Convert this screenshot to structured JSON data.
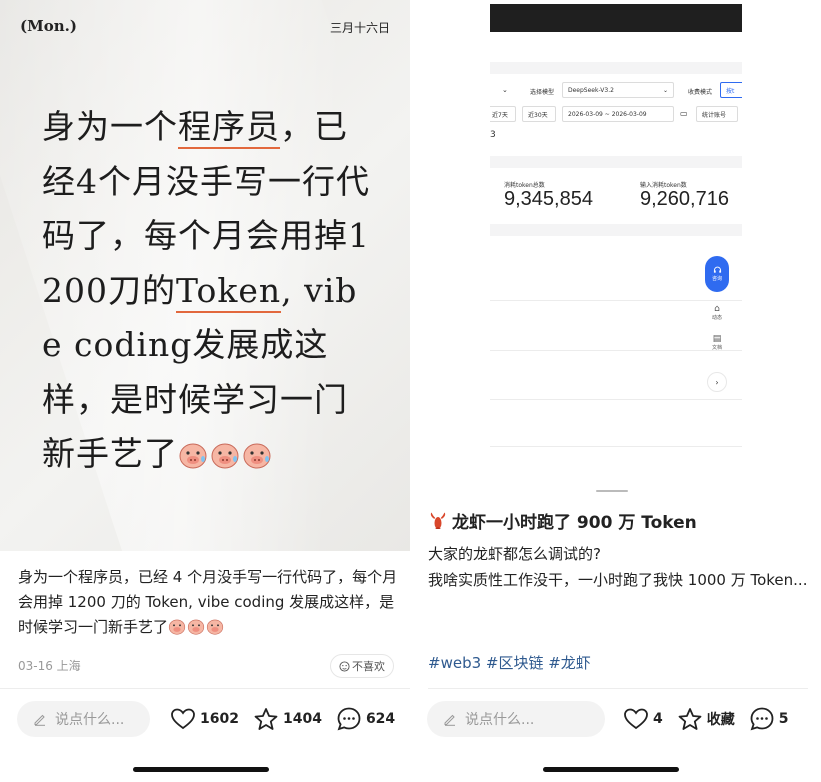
{
  "left_post": {
    "cover": {
      "weekday": "(Mon.)",
      "date": "三月十六日",
      "text_before_ul1": "身为一个",
      "text_ul1": "程序员",
      "text_after_ul1": "，已经4个月没手写一行代码了，每个月会用掉1200刀的",
      "text_ul2": "Token",
      "text_after_ul2": ", vibe coding发展成这样，是时候学习一门新手艺了"
    },
    "caption": "身为一个程序员，已经 4 个月没手写一行代码了，每个月会用掉 1200 刀的 Token, vibe coding 发展成这样，是时候学习一门新手艺了",
    "date_location": "03-16 上海",
    "dislike_label": "不喜欢",
    "comment_placeholder": "说点什么...",
    "likes": "1602",
    "favorites": "1404",
    "comments": "624"
  },
  "right_post": {
    "screenshot": {
      "model_label": "选择模型",
      "model_value": "DeepSeek-V3.2",
      "billing_label": "收费模式",
      "billing_btn": "按t",
      "range_7": "近7天",
      "range_30": "近30天",
      "date_start": "2026-03-09",
      "date_end": "~ 2026-03-09",
      "account_label": "统计账号",
      "stray_3": "3",
      "consumed_label": "消耗token总数",
      "consumed_value": "9,345,854",
      "input_label": "输入消耗token数",
      "input_value": "9,260,716",
      "float_label": "咨询",
      "side_1": "动态",
      "side_2": "文档",
      "circle": "›"
    },
    "title": "龙虾一小时跑了 900 万 Token",
    "body_line1": "大家的龙虾都怎么调试的?",
    "body_line2": "我啥实质性工作没干，一小时跑了我快 1000 万 Token...",
    "tags": "#web3 #区块链 #龙虾",
    "comment_placeholder": "说点什么...",
    "likes": "4",
    "favorites_label": "收藏",
    "comments": "5"
  },
  "colors": {
    "underline": "#e2683d",
    "tag_blue": "#2f5a8f",
    "float_blue": "#2f6bf0"
  },
  "icons": [
    "heart-icon",
    "star-icon",
    "comment-bubble-icon",
    "pencil-icon",
    "smile-icon",
    "pig-face-emoji",
    "lobster-emoji"
  ]
}
